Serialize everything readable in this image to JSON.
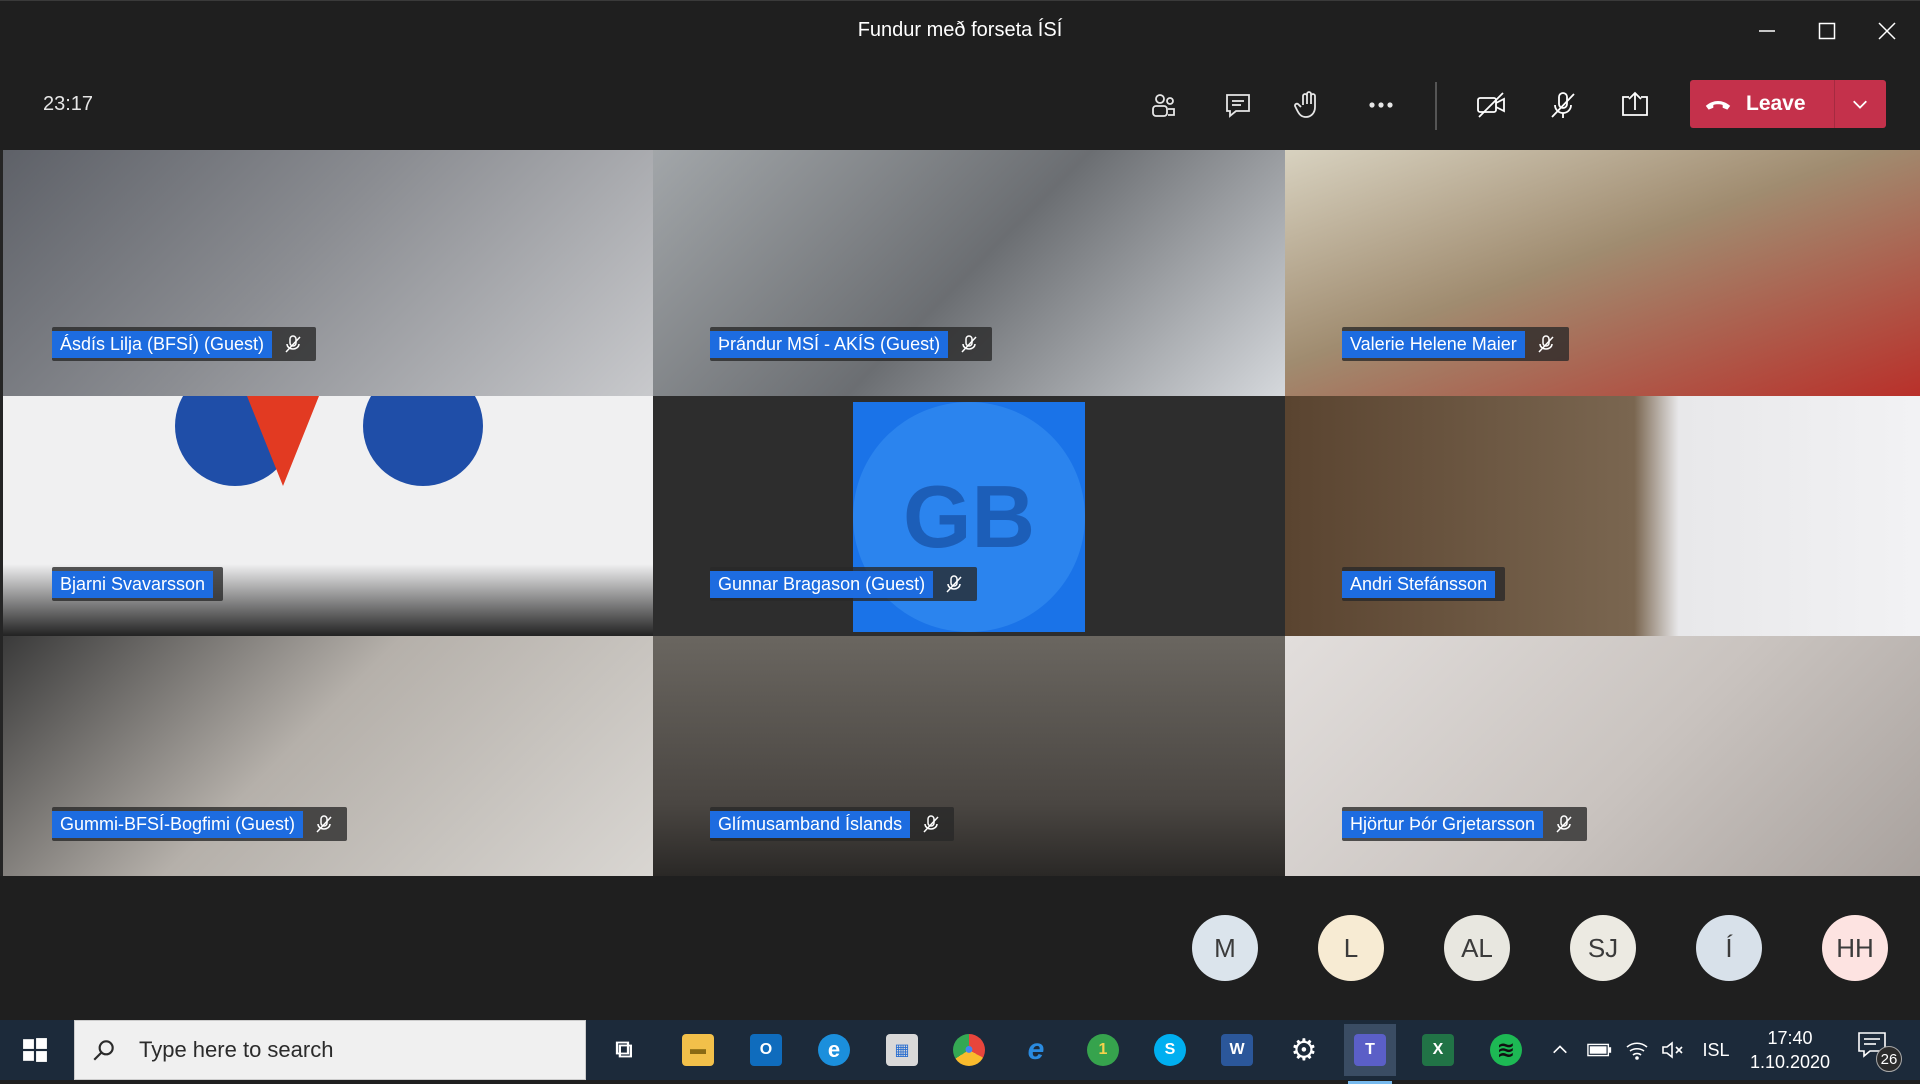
{
  "window": {
    "title": "Fundur með forseta ÍSÍ",
    "minimize_icon": "minimize-icon",
    "maximize_icon": "maximize-icon",
    "close_icon": "close-icon"
  },
  "callbar": {
    "timer": "23:17",
    "buttons": [
      {
        "name": "participants",
        "icon": "people-icon"
      },
      {
        "name": "chat",
        "icon": "chat-icon"
      },
      {
        "name": "raise-hand",
        "icon": "hand-icon"
      },
      {
        "name": "more",
        "icon": "more-icon"
      },
      {
        "name": "camera-off",
        "icon": "camera-off-icon"
      },
      {
        "name": "mic-off",
        "icon": "mic-off-icon"
      },
      {
        "name": "share",
        "icon": "share-icon"
      }
    ],
    "leave_label": "Leave",
    "leave_color": "#c4314b"
  },
  "participants": [
    {
      "name": "Ásdís Lilja (BFSÍ) (Guest)",
      "muted": true,
      "bg": "#7d7f86"
    },
    {
      "name": "Þrándur MSÍ - AKÍS (Guest)",
      "muted": true,
      "bg": "#8c8f92"
    },
    {
      "name": "Valerie Helene Maier",
      "muted": true,
      "bg": "#b2a98f"
    },
    {
      "name": "Bjarni Svavarsson",
      "muted": false,
      "bg": "#e9e9ea"
    },
    {
      "name": "Gunnar Bragason (Guest)",
      "muted": true,
      "bg": "#2b2b2b",
      "initials": "GB",
      "avatar_color": "#1a73e8"
    },
    {
      "name": "Andri Stefánsson",
      "muted": false,
      "bg": "#6e5a45"
    },
    {
      "name": "Gummi-BFSÍ-Bogfimi (Guest)",
      "muted": true,
      "bg": "#8a8580"
    },
    {
      "name": "Glímusamband Íslands",
      "muted": true,
      "bg": "#5b5650"
    },
    {
      "name": "Hjörtur Þór Grjetarsson",
      "muted": true,
      "bg": "#cfcac7"
    }
  ],
  "roster": [
    {
      "initials": "M",
      "color": "#dbe4ec"
    },
    {
      "initials": "L",
      "color": "#f7ebd3"
    },
    {
      "initials": "AL",
      "color": "#e8e7e0"
    },
    {
      "initials": "SJ",
      "color": "#eceae2"
    },
    {
      "initials": "Í",
      "color": "#d8e1ea"
    },
    {
      "initials": "HH",
      "color": "#fde3e1"
    }
  ],
  "taskbar": {
    "search_placeholder": "Type here to search",
    "apps": [
      {
        "name": "task-view",
        "icon": "task-view-icon",
        "color": "#1c2a3a",
        "label": "⧉"
      },
      {
        "name": "file-explorer",
        "icon": "folder-icon",
        "color": "#f2c04a",
        "label": "▬"
      },
      {
        "name": "outlook",
        "icon": "outlook-icon",
        "color": "#0f6cbd",
        "label": "O"
      },
      {
        "name": "edge",
        "icon": "edge-icon",
        "color": "#1b8fdc",
        "label": "e"
      },
      {
        "name": "store",
        "icon": "store-icon",
        "color": "#d9d9d9",
        "label": "▦"
      },
      {
        "name": "chrome",
        "icon": "chrome-icon",
        "color": "#e8453c",
        "label": "●"
      },
      {
        "name": "internet-explorer",
        "icon": "ie-icon",
        "color": "#2a8be0",
        "label": "e"
      },
      {
        "name": "one",
        "icon": "app-one-icon",
        "color": "#36a34d",
        "label": "1"
      },
      {
        "name": "skype",
        "icon": "skype-icon",
        "color": "#00aff0",
        "label": "S"
      },
      {
        "name": "word",
        "icon": "word-icon",
        "color": "#2b579a",
        "label": "W"
      },
      {
        "name": "settings",
        "icon": "gear-icon",
        "color": "#1c2a3a",
        "label": "⚙"
      },
      {
        "name": "teams",
        "icon": "teams-icon",
        "color": "#5b5fc7",
        "label": "T"
      },
      {
        "name": "excel",
        "icon": "excel-icon",
        "color": "#217346",
        "label": "X"
      },
      {
        "name": "spotify",
        "icon": "spotify-icon",
        "color": "#1db954",
        "label": "≋"
      }
    ],
    "language": "ISL",
    "time": "17:40",
    "date": "1.10.2020",
    "notification_count": "26"
  }
}
